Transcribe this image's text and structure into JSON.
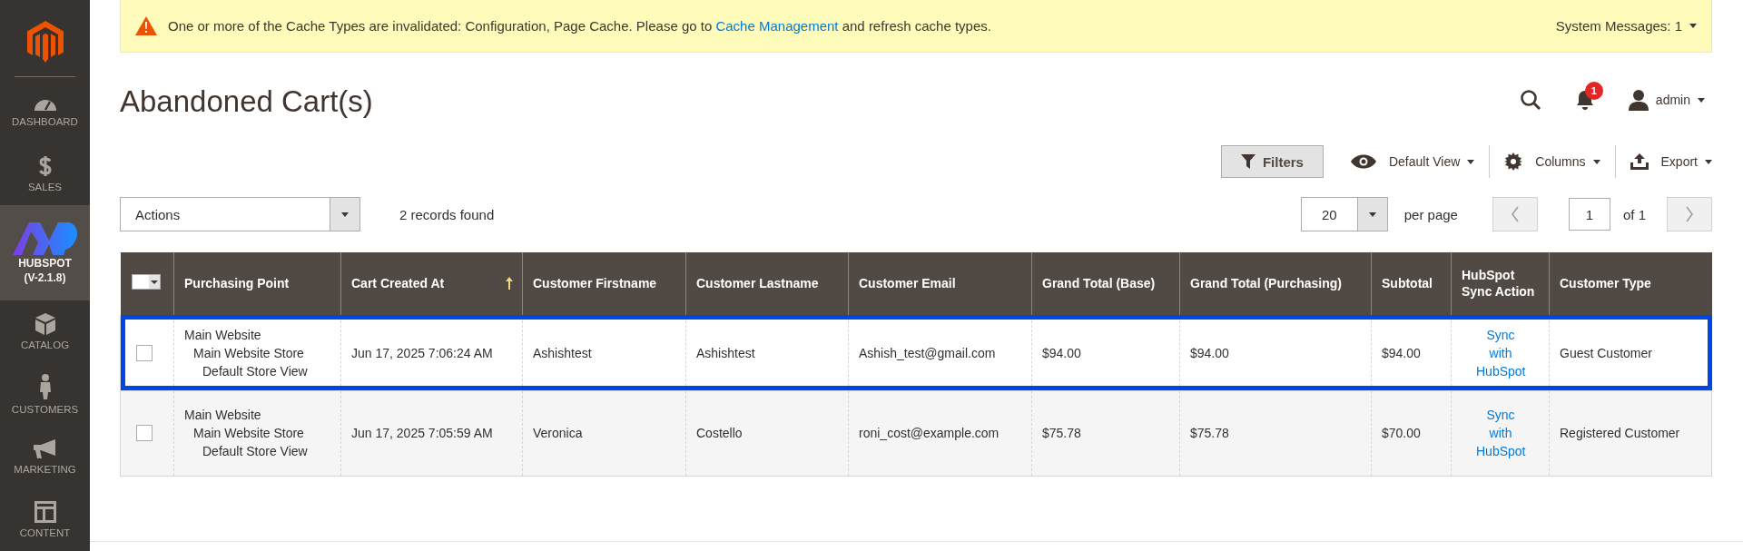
{
  "sidebar": {
    "items": [
      {
        "label": "DASHBOARD",
        "selected": false
      },
      {
        "label": "SALES",
        "selected": false
      },
      {
        "label": "HUBSPOT",
        "version": "(V-2.1.8)",
        "selected": true
      },
      {
        "label": "CATALOG",
        "selected": false
      },
      {
        "label": "CUSTOMERS",
        "selected": false
      },
      {
        "label": "MARKETING",
        "selected": false
      },
      {
        "label": "CONTENT",
        "selected": false
      }
    ]
  },
  "system_message": {
    "text_before": "One or more of the Cache Types are invalidated: Configuration, Page Cache. Please go to ",
    "link": "Cache Management",
    "text_after": " and refresh cache types.",
    "counter": "System Messages: 1"
  },
  "page_title": "Abandoned Cart(s)",
  "header": {
    "notification_count": "1",
    "user": "admin"
  },
  "toolbar": {
    "filters": "Filters",
    "view": "Default View",
    "columns": "Columns",
    "export": "Export"
  },
  "grid_controls": {
    "actions": "Actions",
    "records": "2 records found",
    "per_page_value": "20",
    "per_page_label": "per page",
    "page": "1",
    "page_total": "of 1",
    "prev_disabled": true,
    "next_disabled": true
  },
  "table": {
    "columns": [
      {
        "kind": "mass_select"
      },
      {
        "kind": "text",
        "label": "Purchasing Point",
        "sorted": false
      },
      {
        "kind": "text",
        "label": "Cart Created At",
        "sorted": true
      },
      {
        "kind": "text",
        "label": "Customer Firstname",
        "sorted": false
      },
      {
        "kind": "text",
        "label": "Customer Lastname",
        "sorted": false
      },
      {
        "kind": "text",
        "label": "Customer Email",
        "sorted": false
      },
      {
        "kind": "text",
        "label": "Grand Total (Base)",
        "sorted": false
      },
      {
        "kind": "text",
        "label": "Grand Total (Purchasing)",
        "sorted": false
      },
      {
        "kind": "text",
        "label": "Subtotal",
        "sorted": false
      },
      {
        "kind": "text",
        "label": "HubSpot Sync Action",
        "sorted": false
      },
      {
        "kind": "text",
        "label": "Customer Type",
        "sorted": false
      }
    ],
    "rows": [
      {
        "highlighted": true,
        "cells": [
          {
            "kind": "checkbox",
            "checked": false
          },
          {
            "kind": "lines",
            "lines": [
              "Main Website",
              "Main Website Store",
              "Default Store View"
            ]
          },
          {
            "kind": "text",
            "text": "Jun 17, 2025 7:06:24 AM"
          },
          {
            "kind": "text",
            "text": "Ashishtest"
          },
          {
            "kind": "text",
            "text": "Ashishtest"
          },
          {
            "kind": "text",
            "text": "Ashish_test@gmail.com"
          },
          {
            "kind": "text",
            "text": "$94.00"
          },
          {
            "kind": "text",
            "text": "$94.00"
          },
          {
            "kind": "text",
            "text": "$94.00"
          },
          {
            "kind": "link",
            "text": "Sync with HubSpot"
          },
          {
            "kind": "text",
            "text": "Guest Customer"
          }
        ]
      },
      {
        "highlighted": false,
        "cells": [
          {
            "kind": "checkbox",
            "checked": false
          },
          {
            "kind": "lines",
            "lines": [
              "Main Website",
              "Main Website Store",
              "Default Store View"
            ]
          },
          {
            "kind": "text",
            "text": "Jun 17, 2025 7:05:59 AM"
          },
          {
            "kind": "text",
            "text": "Veronica"
          },
          {
            "kind": "text",
            "text": "Costello"
          },
          {
            "kind": "text",
            "text": "roni_cost@example.com"
          },
          {
            "kind": "text",
            "text": "$75.78"
          },
          {
            "kind": "text",
            "text": "$75.78"
          },
          {
            "kind": "text",
            "text": "$70.00"
          },
          {
            "kind": "link",
            "text": "Sync with HubSpot"
          },
          {
            "kind": "text",
            "text": "Registered Customer"
          }
        ]
      }
    ]
  }
}
